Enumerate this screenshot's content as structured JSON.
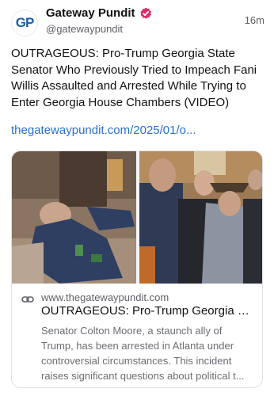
{
  "account": {
    "avatar_text": "GP",
    "name": "Gateway Pundit",
    "handle": "@gatewaypundit",
    "time": "16m",
    "verified_icon": "verified-badge-icon",
    "verified_color": "#e02b6b"
  },
  "post": {
    "text": "OUTRAGEOUS: Pro-Trump Georgia State Senator Who Previously Tried to Impeach Fani Willis Assaulted and Arrested While Trying to Enter Georgia House Chambers (VIDEO)",
    "link": "thegatewaypundit.com/2025/01/o..."
  },
  "card": {
    "domain": "www.thegatewaypundit.com",
    "title": "OUTRAGEOUS: Pro-Trump Georgia St...",
    "description": "Senator Colton Moore, a staunch ally of Trump, has been arrested in Atlanta under controversial circumstances. This incident raises significant questions about political t...",
    "link_icon": "link-icon"
  }
}
